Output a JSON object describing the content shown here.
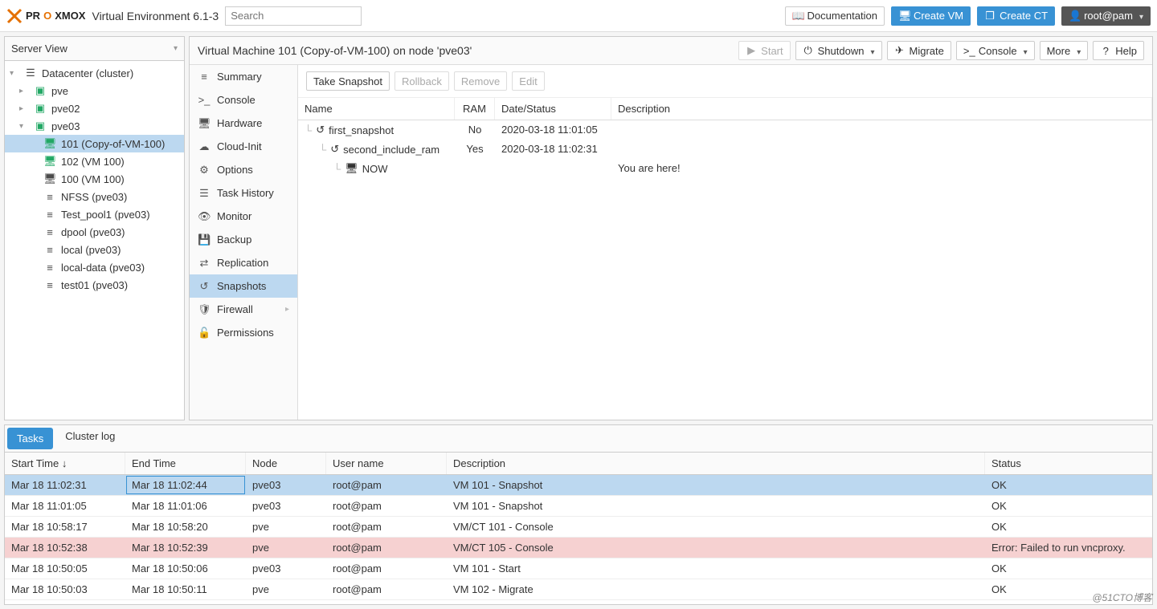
{
  "header": {
    "product": "PROXMOX",
    "version": "Virtual Environment 6.1-3",
    "search_placeholder": "Search",
    "doc": "Documentation",
    "create_vm": "Create VM",
    "create_ct": "Create CT",
    "user": "root@pam"
  },
  "tree": {
    "header": "Server View",
    "root": "Datacenter (cluster)",
    "nodes": [
      {
        "id": "pve",
        "label": "pve"
      },
      {
        "id": "pve02",
        "label": "pve02"
      },
      {
        "id": "pve03",
        "label": "pve03",
        "expanded": true,
        "children": [
          {
            "id": "101",
            "label": "101 (Copy-of-VM-100)",
            "type": "vm",
            "selected": true
          },
          {
            "id": "102",
            "label": "102 (VM 100)",
            "type": "vm"
          },
          {
            "id": "100",
            "label": "100 (VM 100)",
            "type": "vm-off"
          },
          {
            "id": "nfss",
            "label": "NFSS (pve03)",
            "type": "storage"
          },
          {
            "id": "tp1",
            "label": "Test_pool1 (pve03)",
            "type": "storage"
          },
          {
            "id": "dpool",
            "label": "dpool (pve03)",
            "type": "storage"
          },
          {
            "id": "local",
            "label": "local (pve03)",
            "type": "storage"
          },
          {
            "id": "localdata",
            "label": "local-data (pve03)",
            "type": "storage"
          },
          {
            "id": "test01",
            "label": "test01 (pve03)",
            "type": "storage"
          }
        ]
      }
    ]
  },
  "vm": {
    "title": "Virtual Machine 101 (Copy-of-VM-100) on node 'pve03'",
    "actions": {
      "start": "Start",
      "shutdown": "Shutdown",
      "migrate": "Migrate",
      "console": "Console",
      "more": "More",
      "help": "Help"
    },
    "menu": [
      "Summary",
      "Console",
      "Hardware",
      "Cloud-Init",
      "Options",
      "Task History",
      "Monitor",
      "Backup",
      "Replication",
      "Snapshots",
      "Firewall",
      "Permissions"
    ],
    "menu_active": "Snapshots"
  },
  "snapshots": {
    "toolbar": {
      "take": "Take Snapshot",
      "rollback": "Rollback",
      "remove": "Remove",
      "edit": "Edit"
    },
    "columns": {
      "name": "Name",
      "ram": "RAM",
      "date": "Date/Status",
      "desc": "Description"
    },
    "rows": [
      {
        "name": "first_snapshot",
        "ram": "No",
        "date": "2020-03-18 11:01:05",
        "desc": "",
        "level": 0,
        "icon": "snap"
      },
      {
        "name": "second_include_ram",
        "ram": "Yes",
        "date": "2020-03-18 11:02:31",
        "desc": "",
        "level": 1,
        "icon": "snap"
      },
      {
        "name": "NOW",
        "ram": "",
        "date": "",
        "desc": "You are here!",
        "level": 2,
        "icon": "now"
      }
    ]
  },
  "tasks": {
    "tabs": {
      "tasks": "Tasks",
      "cluster": "Cluster log"
    },
    "columns": {
      "start": "Start Time",
      "end": "End Time",
      "node": "Node",
      "user": "User name",
      "desc": "Description",
      "status": "Status"
    },
    "sort_arrow": "↓",
    "rows": [
      {
        "start": "Mar 18 11:02:31",
        "end": "Mar 18 11:02:44",
        "node": "pve03",
        "user": "root@pam",
        "desc": "VM 101 - Snapshot",
        "status": "OK",
        "selected": true
      },
      {
        "start": "Mar 18 11:01:05",
        "end": "Mar 18 11:01:06",
        "node": "pve03",
        "user": "root@pam",
        "desc": "VM 101 - Snapshot",
        "status": "OK"
      },
      {
        "start": "Mar 18 10:58:17",
        "end": "Mar 18 10:58:20",
        "node": "pve",
        "user": "root@pam",
        "desc": "VM/CT 101 - Console",
        "status": "OK"
      },
      {
        "start": "Mar 18 10:52:38",
        "end": "Mar 18 10:52:39",
        "node": "pve",
        "user": "root@pam",
        "desc": "VM/CT 105 - Console",
        "status": "Error: Failed to run vncproxy.",
        "error": true
      },
      {
        "start": "Mar 18 10:50:05",
        "end": "Mar 18 10:50:06",
        "node": "pve03",
        "user": "root@pam",
        "desc": "VM 101 - Start",
        "status": "OK"
      },
      {
        "start": "Mar 18 10:50:03",
        "end": "Mar 18 10:50:11",
        "node": "pve",
        "user": "root@pam",
        "desc": "VM 102 - Migrate",
        "status": "OK"
      }
    ]
  },
  "watermark": "@51CTO博客"
}
